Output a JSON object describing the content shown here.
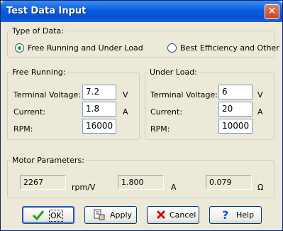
{
  "window": {
    "title": "Test Data Input",
    "close_glyph": "✕"
  },
  "type_of_data": {
    "legend": "Type of Data:",
    "options": [
      {
        "label": "Free Running and Under Load",
        "selected": true
      },
      {
        "label": "Best Efficiency and Other",
        "selected": false
      }
    ]
  },
  "free_running": {
    "legend": "Free Running:",
    "terminal_voltage": {
      "label": "Terminal Voltage:",
      "value": "7.2",
      "unit": "V"
    },
    "current": {
      "label": "Current:",
      "value": "1.8",
      "unit": "A"
    },
    "rpm": {
      "label": "RPM:",
      "value": "16000"
    }
  },
  "under_load": {
    "legend": "Under Load:",
    "terminal_voltage": {
      "label": "Terminal Voltage:",
      "value": "6",
      "unit": "V"
    },
    "current": {
      "label": "Current:",
      "value": "20",
      "unit": "A"
    },
    "rpm": {
      "label": "RPM:",
      "value": "10000"
    }
  },
  "motor_parameters": {
    "legend": "Motor Parameters:",
    "kv": {
      "value": "2267",
      "unit": "rpm/V"
    },
    "io": {
      "value": "1.800",
      "unit": "A"
    },
    "rm": {
      "value": "0.079",
      "unit": "Ω"
    }
  },
  "buttons": {
    "ok": {
      "label": "OK",
      "icon": "check-icon"
    },
    "apply": {
      "label": "Apply",
      "icon": "apply-icon"
    },
    "cancel": {
      "label": "Cancel",
      "icon": "x-icon"
    },
    "help": {
      "label": "Help",
      "icon": "question-icon"
    }
  },
  "colors": {
    "title_bar": "#0a5ee0",
    "dialog_bg": "#ece9d8",
    "check_green": "#21a121",
    "cancel_red": "#d01010",
    "help_blue": "#1f52d0"
  }
}
